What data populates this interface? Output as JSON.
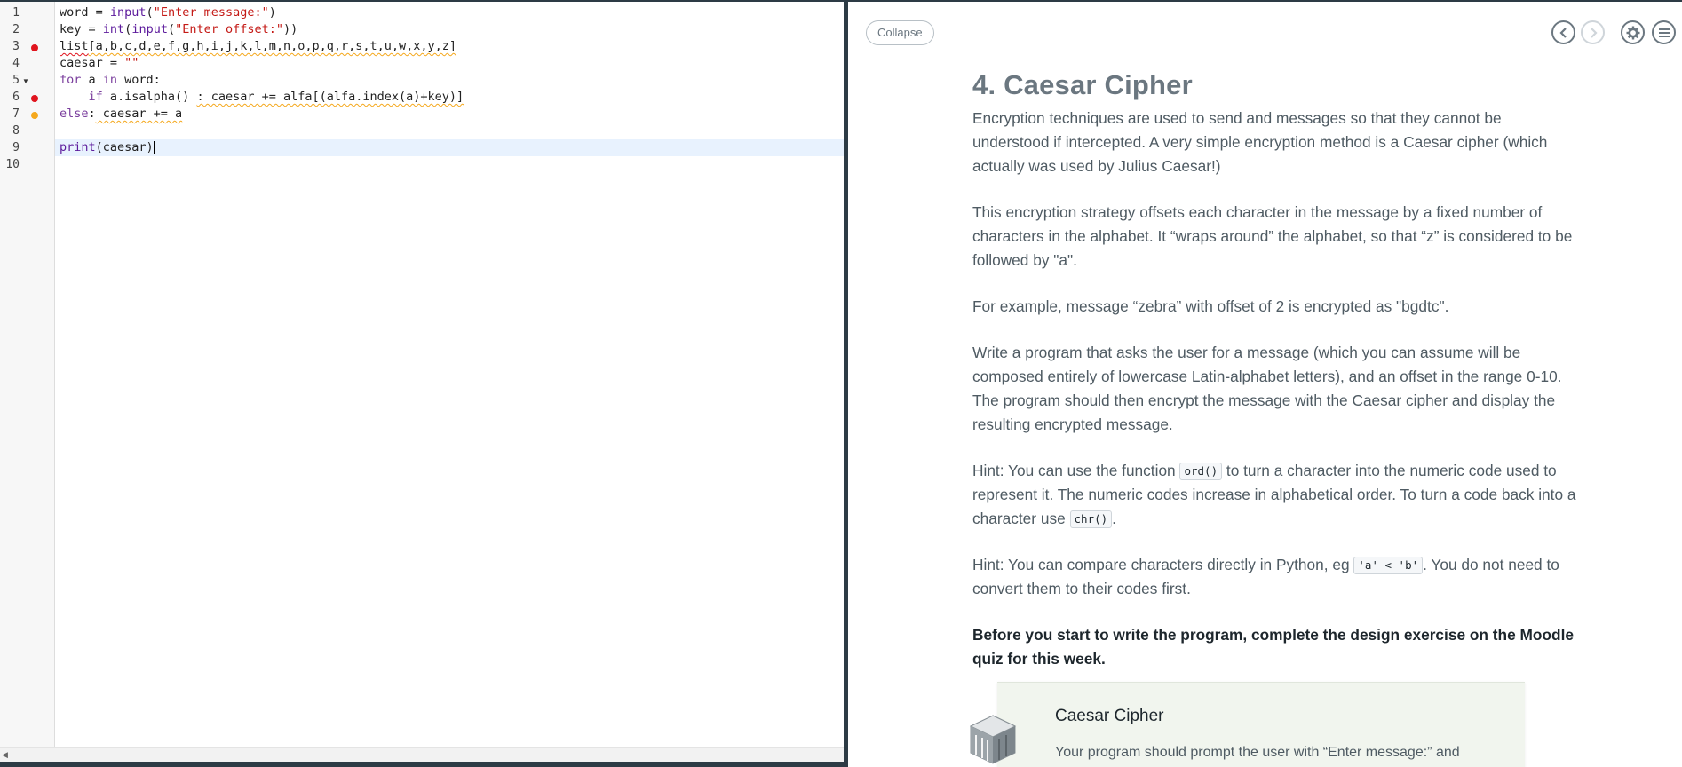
{
  "editor": {
    "line_numbers": [
      "1",
      "2",
      "3",
      "4",
      "5",
      "6",
      "7",
      "8",
      "9",
      "10"
    ],
    "lines": [
      {
        "num": "1",
        "code": [
          [
            "plain",
            "word = "
          ],
          [
            "fn",
            "input"
          ],
          [
            "plain",
            "("
          ],
          [
            "str",
            "\"Enter message:\""
          ],
          [
            "plain",
            ")"
          ]
        ]
      },
      {
        "num": "2",
        "code": [
          [
            "plain",
            "key = "
          ],
          [
            "fn",
            "int"
          ],
          [
            "plain",
            "("
          ],
          [
            "fn",
            "input"
          ],
          [
            "plain",
            "("
          ],
          [
            "str",
            "\"Enter offset:\""
          ],
          [
            "plain",
            "))"
          ]
        ]
      },
      {
        "num": "3",
        "code": [
          [
            "squig-red",
            "list"
          ],
          [
            "squig",
            "[a,b,c,d,e,f,g,h,i,j,k,l,m,n,o,p,q,r,s,t,u,w,x,y,z]"
          ]
        ]
      },
      {
        "num": "4",
        "code": [
          [
            "plain",
            "caesar = "
          ],
          [
            "str",
            "\"\""
          ]
        ]
      },
      {
        "num": "5",
        "code": [
          [
            "kw",
            "for"
          ],
          [
            "plain",
            " a "
          ],
          [
            "kw",
            "in"
          ],
          [
            "plain",
            " word:"
          ]
        ]
      },
      {
        "num": "6",
        "code": [
          [
            "plain",
            "    "
          ],
          [
            "kw",
            "if"
          ],
          [
            "plain",
            " a.isalpha() "
          ],
          [
            "squig",
            ": caesar += alfa[(alfa.index(a)+key)]"
          ]
        ]
      },
      {
        "num": "7",
        "code": [
          [
            "kw",
            "else"
          ],
          [
            "plain",
            ":"
          ],
          [
            "squig",
            " caesar += a"
          ]
        ]
      },
      {
        "num": "8",
        "code": []
      },
      {
        "num": "9",
        "code": [
          [
            "fn",
            "print"
          ],
          [
            "plain",
            "(caesar)"
          ]
        ]
      },
      {
        "num": "10",
        "code": []
      }
    ]
  },
  "panel": {
    "collapse_label": "Collapse",
    "icons": {
      "prev": "chevron-left-icon",
      "next": "chevron-right-icon",
      "settings": "gear-icon",
      "menu": "menu-icon"
    },
    "title": "4. Caesar Cipher",
    "p1": "Encryption techniques are used to send and messages so that they cannot be understood if intercepted. A very simple encryption method is a Caesar cipher (which actually was used by Julius Caesar!)",
    "p2": "This encryption strategy offsets each character in the message by a fixed number of characters in the alphabet. It “wraps around” the alphabet, so that “z” is considered to be followed by \"a\".",
    "p3": "For example, message “zebra” with offset of 2 is encrypted as \"bgdtc\".",
    "p4": "Write a program that asks the user for a message (which you can assume will be composed entirely of lowercase Latin-alphabet letters), and an offset in the range 0-10. The program should then encrypt the message with the Caesar cipher and display the resulting encrypted message.",
    "hint1_a": "Hint: You can use the function ",
    "hint1_code1": "ord()",
    "hint1_b": " to turn a character into the numeric code used to represent it. The numeric codes increase in alphabetical order. To turn a code back into a character use ",
    "hint1_code2": "chr()",
    "hint1_c": ".",
    "hint2_a": "Hint: You can compare characters directly in Python, eg ",
    "hint2_code": "'a' < 'b'",
    "hint2_b": ". You do not need to convert them to their codes first.",
    "bold_note": "Before you start to write the program, complete the design exercise on the Moodle quiz for this week.",
    "card_title": "Caesar Cipher",
    "card_text": "Your program should prompt the user with “Enter message:” and"
  },
  "colors": {
    "dark_chrome": "#2d3b45",
    "error_marker": "#e0141e",
    "warning_marker": "#f5a81d",
    "active_line": "#e8f2fe"
  }
}
